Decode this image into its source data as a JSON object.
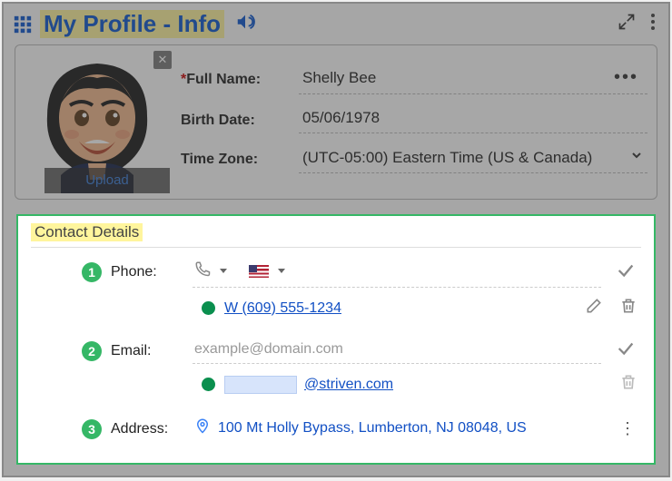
{
  "header": {
    "title": "My Profile - Info"
  },
  "profile": {
    "upload_label": "Upload",
    "fields": {
      "full_name_label": "Full Name:",
      "full_name_value": "Shelly Bee",
      "birth_date_label": "Birth Date:",
      "birth_date_value": "05/06/1978",
      "time_zone_label": "Time Zone:",
      "time_zone_value": "(UTC-05:00) Eastern Time (US & Canada)"
    }
  },
  "contact": {
    "section_title": "Contact Details",
    "phone": {
      "step": "1",
      "label": "Phone:",
      "value": "W (609) 555-1234"
    },
    "email": {
      "step": "2",
      "label": "Email:",
      "placeholder": "example@domain.com",
      "value_suffix": "@striven.com"
    },
    "address": {
      "step": "3",
      "label": "Address:",
      "value": "100 Mt Holly Bypass, Lumberton, NJ 08048, US"
    }
  }
}
